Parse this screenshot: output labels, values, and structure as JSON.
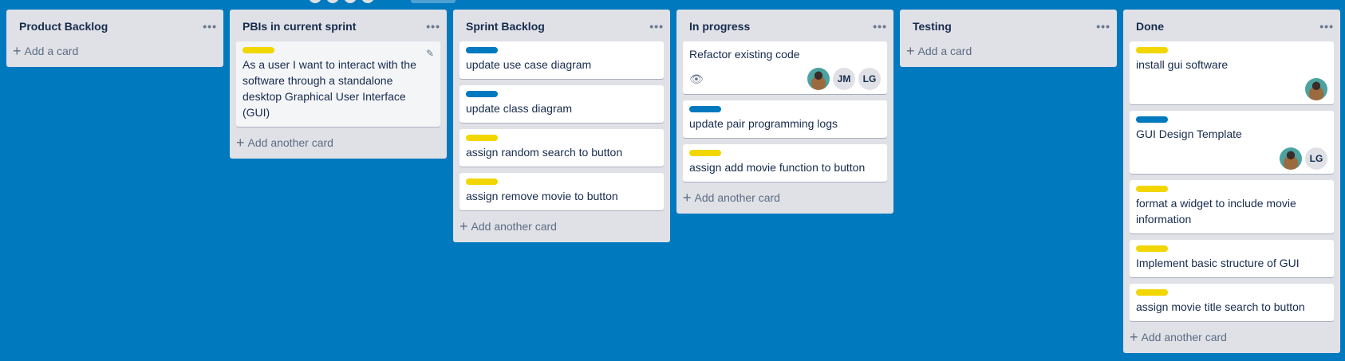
{
  "colors": {
    "background": "#0079bf",
    "list": "#dfe1e6",
    "label_yellow": "#f2d600",
    "label_blue": "#0079bf"
  },
  "lists": [
    {
      "title": "Product Backlog",
      "add_label": "Add a card",
      "cards": []
    },
    {
      "title": "PBIs in current sprint",
      "add_label": "Add another card",
      "cards": [
        {
          "label": "yellow",
          "title": "As a user I want to interact with the software through a standalone desktop Graphical User Interface (GUI)",
          "hover": true
        }
      ]
    },
    {
      "title": "Sprint Backlog",
      "add_label": "Add another card",
      "cards": [
        {
          "label": "blue",
          "title": "update use case diagram"
        },
        {
          "label": "blue",
          "title": "update class diagram"
        },
        {
          "label": "yellow",
          "title": "assign random search to button"
        },
        {
          "label": "yellow",
          "title": "assign remove movie to button"
        }
      ]
    },
    {
      "title": "In progress",
      "add_label": "Add another card",
      "cards": [
        {
          "label": null,
          "title": "Refactor existing code",
          "watch": true,
          "members": [
            "img",
            "JM",
            "LG"
          ]
        },
        {
          "label": "blue",
          "title": "update pair programming logs"
        },
        {
          "label": "yellow",
          "title": "assign add movie function to button"
        }
      ]
    },
    {
      "title": "Testing",
      "add_label": "Add a card",
      "cards": []
    },
    {
      "title": "Done",
      "add_label": "Add another card",
      "cards": [
        {
          "label": "yellow",
          "title": "install gui software",
          "members": [
            "img"
          ]
        },
        {
          "label": "blue",
          "title": "GUI Design Template",
          "members": [
            "img",
            "LG"
          ]
        },
        {
          "label": "yellow",
          "title": "format a widget to include movie information"
        },
        {
          "label": "yellow",
          "title": "Implement basic structure of GUI"
        },
        {
          "label": "yellow",
          "title": "assign movie title search to button"
        }
      ]
    }
  ],
  "icons": {
    "menu": "•••",
    "plus": "+",
    "eye": "👁",
    "pencil": "✎"
  }
}
